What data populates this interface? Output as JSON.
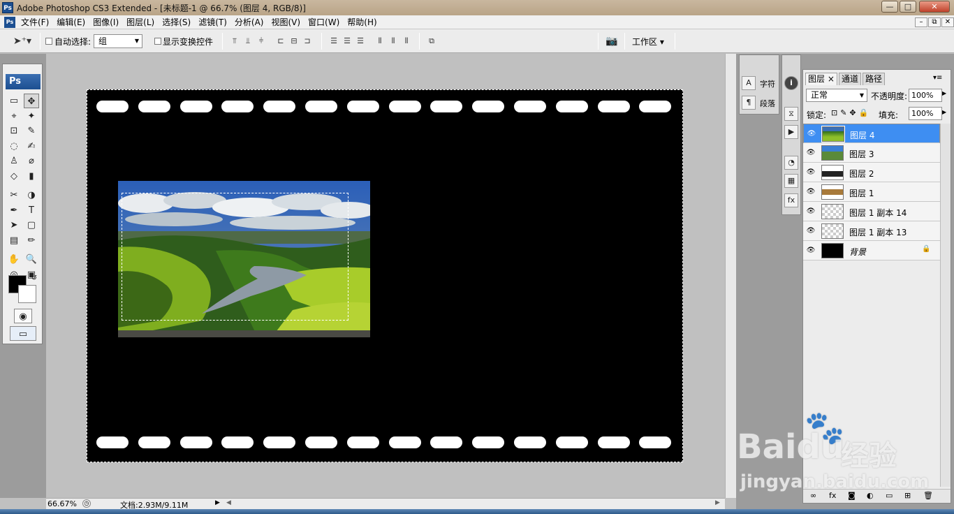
{
  "window": {
    "app_badge": "Ps",
    "title": "Adobe Photoshop CS3 Extended - [未标题-1 @ 66.7% (图层 4, RGB/8)]",
    "minimize": "—",
    "maximize": "□",
    "close": "✕"
  },
  "menubar": {
    "items": [
      "文件(F)",
      "编辑(E)",
      "图像(I)",
      "图层(L)",
      "选择(S)",
      "滤镜(T)",
      "分析(A)",
      "视图(V)",
      "窗口(W)",
      "帮助(H)"
    ],
    "doc_minimize": "–",
    "doc_restore": "⧉",
    "doc_close": "✕"
  },
  "options": {
    "auto_select_label": "自动选择:",
    "auto_select_value": "组",
    "show_transform_label": "显示变换控件",
    "workspace_label": "工作区 ▾"
  },
  "toolbox": {
    "logo": "Ps",
    "tools": [
      "▭",
      "✥",
      "⌖",
      "✦",
      "⊡",
      "✎",
      "◌",
      "✍",
      "♙",
      "⌀",
      "◇",
      "▮",
      "✂",
      "◑",
      "✒",
      "T",
      "➤",
      "▢",
      "▤",
      "✏",
      "✋",
      "🔍",
      "◎",
      "▣"
    ]
  },
  "status": {
    "zoom": "66.67%",
    "doc_info": "文档:2.93M/9.11M"
  },
  "side_panels": {
    "char_label": "字符",
    "para_label": "段落",
    "char_icon": "A",
    "para_icon": "¶"
  },
  "layers_panel": {
    "tabs": [
      "图层",
      "通道",
      "路径"
    ],
    "blend_mode": "正常",
    "opacity_label": "不透明度:",
    "opacity_value": "100%",
    "lock_label": "锁定:",
    "fill_label": "填充:",
    "fill_value": "100%",
    "layers": [
      {
        "name": "图层 4",
        "selected": true
      },
      {
        "name": "图层 3",
        "selected": false
      },
      {
        "name": "图层 2",
        "selected": false
      },
      {
        "name": "图层 1",
        "selected": false
      },
      {
        "name": "图层 1 副本 14",
        "selected": false
      },
      {
        "name": "图层 1 副本 13",
        "selected": false
      },
      {
        "name": "背景",
        "selected": false
      }
    ],
    "footer_icons": [
      "∞",
      "fx",
      "◙",
      "◐",
      "▭",
      "⊞",
      "🗑"
    ]
  },
  "watermark": {
    "brand": "Bai",
    "brand2": "du",
    "cn": "经验",
    "url": "jingyan.baidu.com"
  },
  "colors": {
    "layer_selected": "#3e8ef2",
    "ps_blue": "#1c4f91"
  }
}
